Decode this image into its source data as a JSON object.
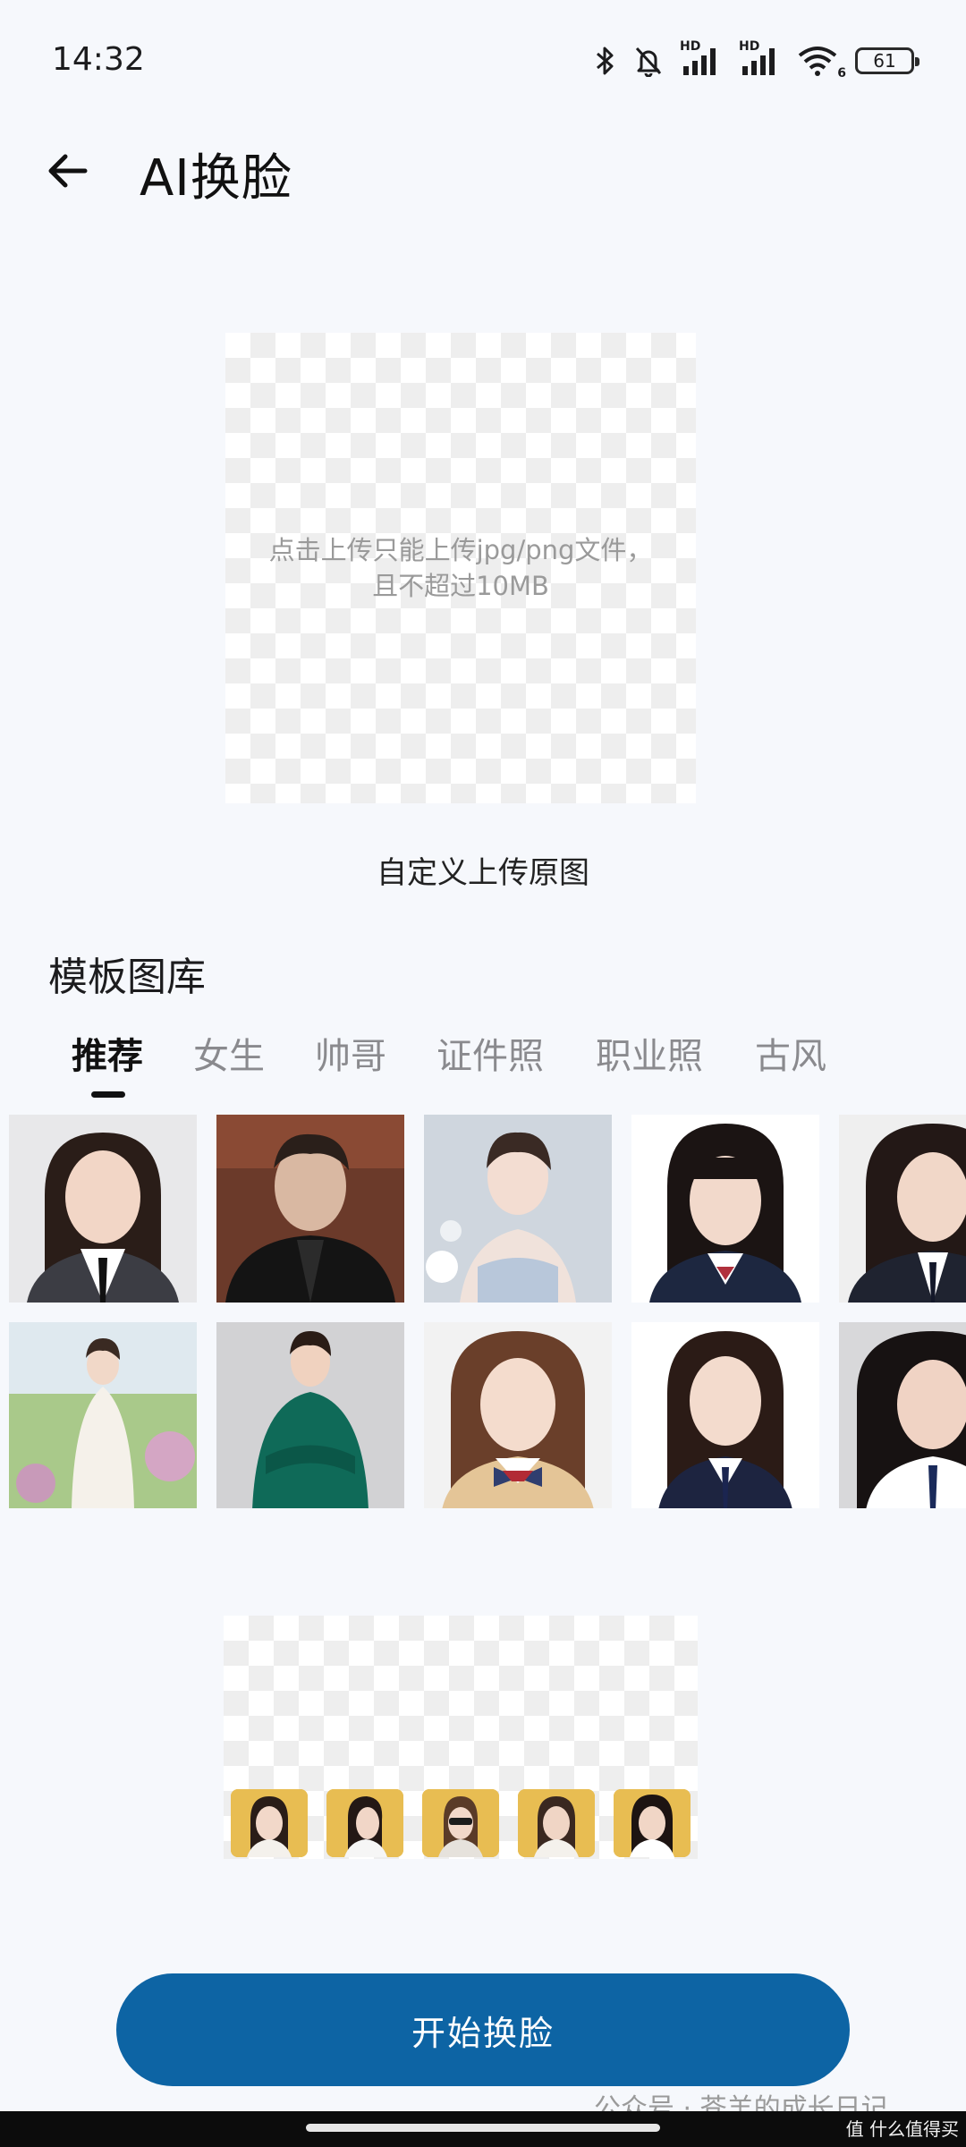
{
  "status_bar": {
    "time": "14:32",
    "battery": "61",
    "network_label_1": "HD",
    "network_label_2": "HD",
    "wifi_badge": "6"
  },
  "header": {
    "title": "AI换脸"
  },
  "upload": {
    "hint_line_1": "点击上传只能上传jpg/png文件，",
    "hint_line_2": "且不超过10MB",
    "caption": "自定义上传原图"
  },
  "templates": {
    "title": "模板图库",
    "tabs": [
      {
        "label": "推荐",
        "active": true
      },
      {
        "label": "女生",
        "active": false
      },
      {
        "label": "帅哥",
        "active": false
      },
      {
        "label": "证件照",
        "active": false
      },
      {
        "label": "职业照",
        "active": false
      },
      {
        "label": "古风",
        "active": false
      }
    ]
  },
  "actions": {
    "start_label": "开始换脸"
  },
  "watermark": {
    "text": "公众号 · 苍羊的成长日记",
    "badge": "值 什么值得买"
  }
}
